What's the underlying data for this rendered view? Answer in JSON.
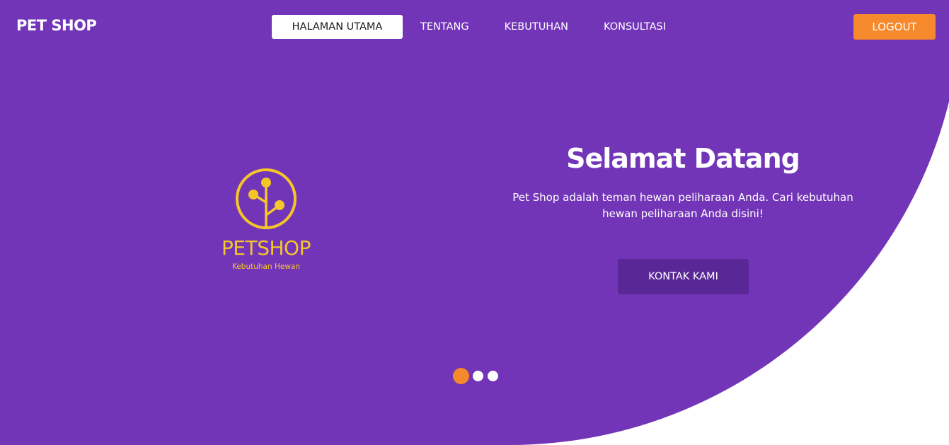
{
  "brand": "PET SHOP",
  "nav": {
    "items": [
      {
        "label": "HALAMAN UTAMA",
        "active": true
      },
      {
        "label": "TENTANG",
        "active": false
      },
      {
        "label": "KEBUTUHAN",
        "active": false
      },
      {
        "label": "KONSULTASI",
        "active": false
      }
    ],
    "logout_label": "LOGOUT"
  },
  "logo": {
    "icon": "tree-circle-icon",
    "name": "PETSHOP",
    "tagline": "Kebutuhan Hewan"
  },
  "hero": {
    "title": "Selamat Datang",
    "description": "Pet Shop adalah teman hewan peliharaan Anda. Cari kebutuhan hewan peliharaan Anda disini!",
    "cta_label": "KONTAK KAMI"
  },
  "carousel": {
    "slide_count": 3,
    "active_index": 0
  },
  "colors": {
    "background": "#7335b7",
    "accent": "#f6892b",
    "logo": "#f5c628",
    "cta": "#5a2896"
  }
}
